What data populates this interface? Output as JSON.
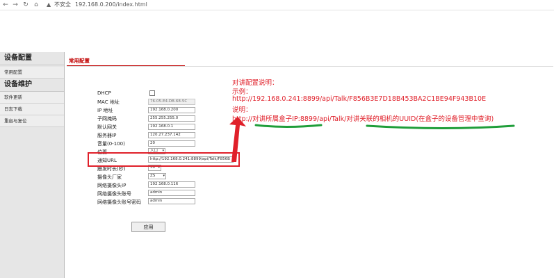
{
  "browser": {
    "back": "←",
    "forward": "→",
    "reload": "↻",
    "home": "⌂",
    "warning_icon": "▲",
    "security_text": "不安全",
    "url": "192.168.0.200/index.html"
  },
  "sidebar": {
    "section1": "设备配置",
    "item_common": "常用配置",
    "section2": "设备维护",
    "item_software": "软件更新",
    "item_log": "日志下载",
    "item_reboot": "重启与复位"
  },
  "main": {
    "title": "常用配置"
  },
  "form": {
    "dhcp_label": "DHCP",
    "dhcp_checked": false,
    "mac_label": "MAC 地址",
    "mac_value": "76-05-E4-DB-68-5C",
    "ip_label": "IP 地址",
    "ip_value": "192.168.0.200",
    "mask_label": "子网掩码",
    "mask_value": "255.255.255.0",
    "gateway_label": "默认网关",
    "gateway_value": "192.168.0.1",
    "server_label": "服务器IP",
    "server_value": "120.27.237.142",
    "volume_label": "音量(0-100)",
    "volume_value": "20",
    "position_label": "位置",
    "position_value": "入口",
    "notify_label": "通知URL",
    "notify_value": "http://192.168.0.241:8899/api/Talk/F856B",
    "trigger_label": "触发时长(秒)",
    "trigger_value": "30",
    "vendor_label": "摄像头厂家",
    "vendor_value": "ZS",
    "cam_ip_label": "网络摄像头IP",
    "cam_ip_value": "192.168.0.116",
    "cam_user_label": "网络摄像头账号",
    "cam_user_value": "admin",
    "cam_pass_label": "网络摄像头账号密码",
    "cam_pass_value": "admin",
    "apply_label": "应用"
  },
  "annotation": {
    "heading": "对讲配置说明：",
    "example_label": "示例：",
    "example_url": "http://192.168.0.241:8899/api/Talk/F856B3E7D18B453BA2C1BE94F943B10E",
    "note_label": "说明：",
    "note_text": "http://对讲所属盒子IP:8899/api/Talk/对讲关联的相机的UUID(在盒子的设备管理中查询)",
    "red_color": "#e0202a",
    "green_color": "#1f9e3a"
  }
}
